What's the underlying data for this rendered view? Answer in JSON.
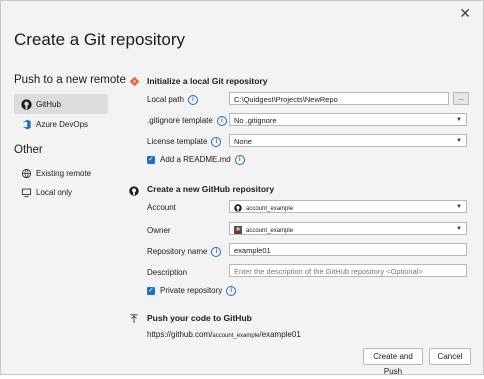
{
  "dialog": {
    "title": "Create a Git repository",
    "close_glyph": "✕"
  },
  "sidebar": {
    "push_header": "Push to a new remote",
    "push_items": [
      {
        "label": "GitHub",
        "icon": "github-icon"
      },
      {
        "label": "Azure DevOps",
        "icon": "azure-devops-icon"
      }
    ],
    "other_header": "Other",
    "other_items": [
      {
        "label": "Existing remote",
        "icon": "remote-icon"
      },
      {
        "label": "Local only",
        "icon": "local-icon"
      }
    ]
  },
  "local": {
    "header": "Initialize a local Git repository",
    "path_label": "Local path",
    "path_value": "C:\\Quidgest\\Projects\\NewRepo",
    "browse_label": "...",
    "gitignore_label": ".gitignore template",
    "gitignore_value": "No .gitignore",
    "license_label": "License template",
    "license_value": "None",
    "readme_label": "Add a README.md",
    "readme_checked": true
  },
  "github": {
    "header": "Create a new GitHub repository",
    "account_label": "Account",
    "account_value": "account_example",
    "owner_label": "Owner",
    "owner_value": "account_example",
    "repo_label": "Repository name",
    "repo_value": "example01",
    "desc_label": "Description",
    "desc_placeholder": "Enter the description of the GitHub repository <Optional>",
    "private_label": "Private repository",
    "private_checked": true
  },
  "push": {
    "header": "Push your code to GitHub",
    "url_prefix": "https://github.com/",
    "url_account": "account_example",
    "url_suffix": "/example01"
  },
  "footer": {
    "create_label": "Create and Push",
    "cancel_label": "Cancel"
  },
  "colors": {
    "accent": "#1f6fc6",
    "selection": "#dcdcdc",
    "local_icon": "#e8643c"
  }
}
